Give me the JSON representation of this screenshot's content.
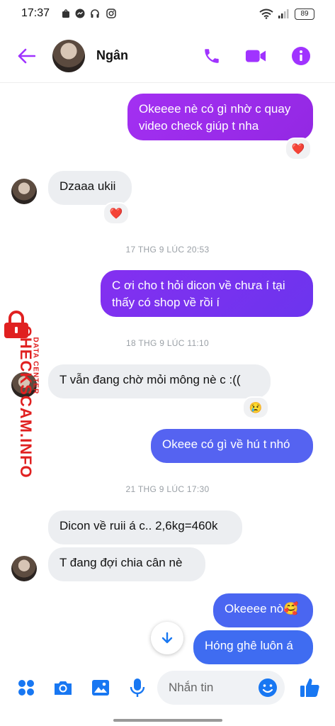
{
  "status_bar": {
    "time": "17:37",
    "battery": "89"
  },
  "header": {
    "contact_name": "Ngân"
  },
  "messages": {
    "m1": "Okeeee nè có gì nhờ c quay video check giúp t nha",
    "m2": "Dzaaa ukii",
    "ts1": "17 THG 9 LÚC 20:53",
    "m3": "C ơi cho t hỏi dicon về chưa í tại thấy có shop về rồi í",
    "ts2": "18 THG 9 LÚC 11:10",
    "m4": "T vẫn đang chờ mỏi mông nè c :((",
    "m5": "Okeee có gì về hú t nhó",
    "ts3": "21 THG 9 LÚC 17:30",
    "m6": "Dicon về ruii á c.. 2,6kg=460k",
    "m7": "T đang đợi chia cân nè",
    "m8": "Okeeee nò🥰",
    "m9": "Hóng ghê luôn á"
  },
  "reactions": {
    "heart": "❤️",
    "cry": "😢"
  },
  "watermark": {
    "brand": "CHECKSCAM.INFO",
    "tag": "DATA CENTER"
  },
  "composer": {
    "placeholder": "Nhắn tin"
  },
  "colors": {
    "accent": "#a033ff",
    "purple_bubble": "#9b2ee8",
    "blue_bubble": "#4e5ff0"
  }
}
